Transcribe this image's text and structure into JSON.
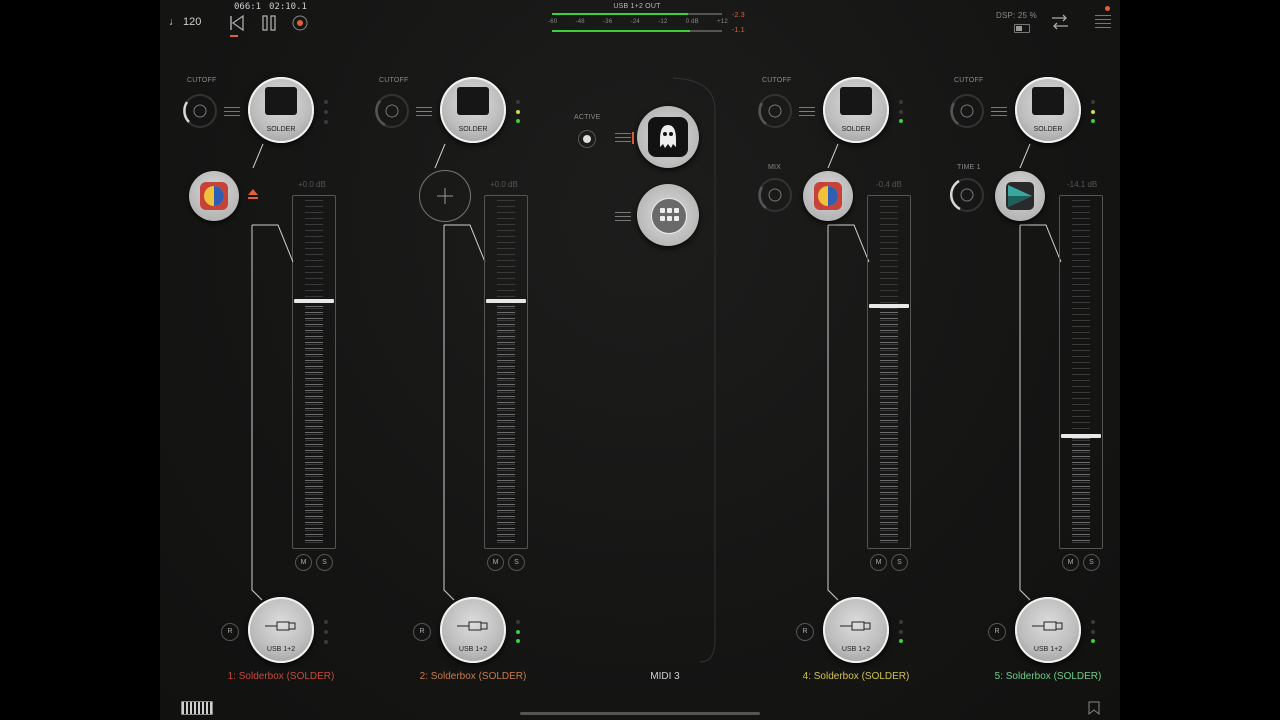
{
  "transport": {
    "tempo": "♩ 120",
    "bars": "066:1",
    "time": "02:10.1"
  },
  "master_meter": {
    "label": "USB 1+2 OUT",
    "scale": [
      "-60",
      "-48",
      "-36",
      "-24",
      "-12",
      "0 dB",
      "+12"
    ],
    "peak_l": "-2.3",
    "peak_r": "-1.1"
  },
  "status": {
    "dsp": "DSP: 25 %"
  },
  "channels": [
    {
      "name": "1: Solderbox (SOLDER)",
      "name_color": "#c9473d",
      "cutoff_label": "CUTOFF",
      "source": "SOLDER",
      "db": "+0.0 dB",
      "mute": "M",
      "solo": "S",
      "record": "R",
      "output": "USB 1+2"
    },
    {
      "name": "2: Solderbox (SOLDER)",
      "name_color": "#c97a4a",
      "cutoff_label": "CUTOFF",
      "source": "SOLDER",
      "db": "+0.0 dB",
      "mute": "M",
      "solo": "S",
      "record": "R",
      "output": "USB 1+2"
    },
    {
      "name": "4: Solderbox (SOLDER)",
      "name_color": "#d2c24c",
      "cutoff_label": "CUTOFF",
      "fx_label": "MIX",
      "source": "SOLDER",
      "db": "-0.4 dB",
      "mute": "M",
      "solo": "S",
      "record": "R",
      "output": "USB 1+2"
    },
    {
      "name": "5: Solderbox (SOLDER)",
      "name_color": "#6fce8a",
      "cutoff_label": "CUTOFF",
      "fx_label": "TIME 1",
      "source": "SOLDER",
      "db": "-14.1 dB",
      "mute": "M",
      "solo": "S",
      "record": "R",
      "output": "USB 1+2"
    }
  ],
  "midi": {
    "name": "MIDI 3",
    "active_label": "ACTIVE"
  },
  "icons": [
    "metronome-note",
    "rewind-icon",
    "pause-icon",
    "record-icon",
    "battery-icon",
    "routing-icon",
    "menu-icon",
    "keyboard-icon",
    "bookmark-icon",
    "octopus-icon",
    "grid-pads-icon",
    "add-effect-icon",
    "eject-icon",
    "usb-plug-icon"
  ],
  "colors": {
    "accent": "#e0603a",
    "green": "#3ad13a",
    "bg": "#151514"
  }
}
